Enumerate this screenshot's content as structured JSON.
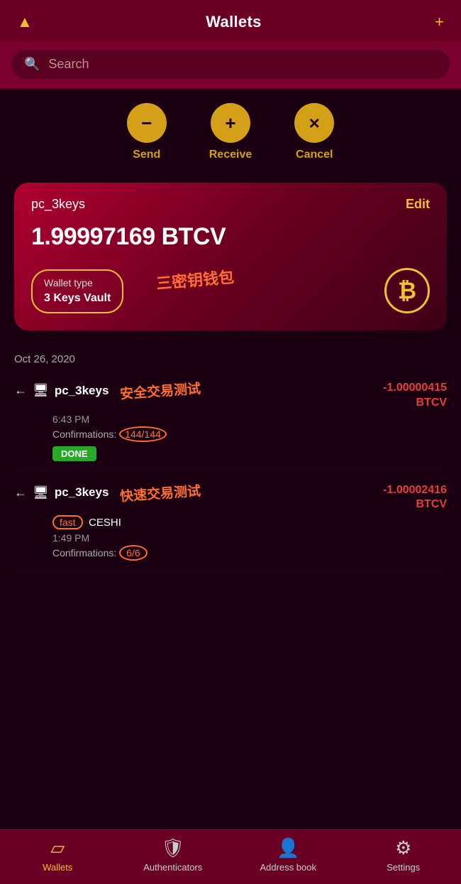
{
  "header": {
    "title": "Wallets",
    "filter_icon": "▼",
    "add_icon": "+"
  },
  "search": {
    "placeholder": "Search"
  },
  "actions": [
    {
      "id": "send",
      "icon": "−",
      "label": "Send"
    },
    {
      "id": "receive",
      "icon": "+",
      "label": "Receive"
    },
    {
      "id": "cancel",
      "icon": "×",
      "label": "Cancel"
    }
  ],
  "wallet_card": {
    "name": "pc_3keys",
    "edit_label": "Edit",
    "balance": "1.99997169 BTCV",
    "wallet_type_label": "Wallet type",
    "wallet_type_value": "3 Keys Vault",
    "btc_symbol": "₿",
    "annotation": "三密钥钱包"
  },
  "transactions": {
    "date": "Oct 26, 2020",
    "items": [
      {
        "id": "tx1",
        "arrow": "←",
        "wallet_icon": "🖥",
        "wallet_name": "pc_3keys",
        "annotation": "安全交易测试",
        "time": "6:43 PM",
        "confirmations_label": "Confirmations:",
        "confirmations_value": "144/144",
        "status": "DONE",
        "amount": "-1.00000415",
        "currency": "BTCV"
      },
      {
        "id": "tx2",
        "arrow": "←",
        "wallet_icon": "🖥",
        "wallet_name": "pc_3keys",
        "annotation": "快速交易测试",
        "fast_label": "fast",
        "note_label": "CESHI",
        "time": "1:49 PM",
        "confirmations_label": "Confirmations:",
        "confirmations_value": "6/6",
        "amount": "-1.00002416",
        "currency": "BTCV"
      }
    ]
  },
  "nav": [
    {
      "id": "wallets",
      "icon": "▤",
      "label": "Wallets",
      "active": true
    },
    {
      "id": "authenticators",
      "icon": "🛡",
      "label": "Authenticators",
      "active": false
    },
    {
      "id": "address-book",
      "icon": "👤",
      "label": "Address book",
      "active": false
    },
    {
      "id": "settings",
      "icon": "⚙",
      "label": "Settings",
      "active": false
    }
  ]
}
